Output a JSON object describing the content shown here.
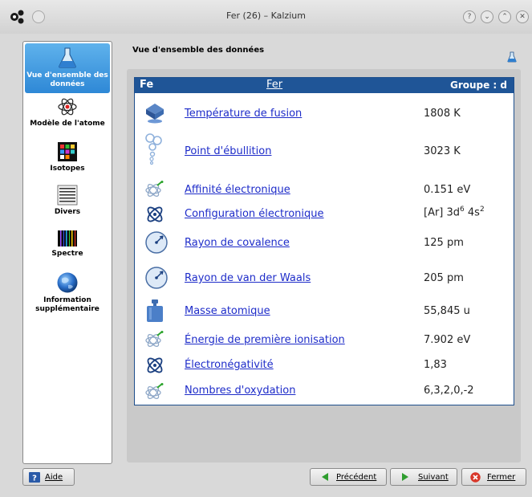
{
  "window": {
    "title": "Fer (26) – Kalzium"
  },
  "sidebar": {
    "items": [
      {
        "label": "Vue d'ensemble des données",
        "icon": "flask-icon",
        "active": true
      },
      {
        "label": "Modèle de l'atome",
        "icon": "atom-icon"
      },
      {
        "label": "Isotopes",
        "icon": "isotopes-icon"
      },
      {
        "label": "Divers",
        "icon": "misc-icon"
      },
      {
        "label": "Spectre",
        "icon": "spectrum-icon"
      },
      {
        "label": "Information supplémentaire",
        "icon": "globe-icon"
      }
    ]
  },
  "main": {
    "title": "Vue d'ensemble des données",
    "table": {
      "symbol": "Fe",
      "name": "Fer",
      "group": "Groupe : d",
      "rows": [
        {
          "label": "Température de fusion",
          "value": "1808 K",
          "icon": "melting-icon"
        },
        {
          "label": "Point d'ébullition",
          "value": "3023 K",
          "icon": "boiling-icon"
        },
        {
          "label": "Affinité électronique",
          "value": "0.151 eV",
          "icon": "electron-affinity-icon"
        },
        {
          "label": "Configuration électronique",
          "value_base": "[Ar] 3d",
          "value_sup1": "6",
          "value_mid": " 4s",
          "value_sup2": "2",
          "icon": "orbital-icon"
        },
        {
          "label": "Rayon de covalence",
          "value": "125 pm",
          "icon": "radius-icon"
        },
        {
          "label": "Rayon de van der Waals",
          "value": "205 pm",
          "icon": "radius-icon"
        },
        {
          "label": "Masse atomique",
          "value": "55,845 u",
          "icon": "mass-icon"
        },
        {
          "label": "Énergie de première ionisation",
          "value": "7.902 eV",
          "icon": "ionization-icon"
        },
        {
          "label": "Électronégativité",
          "value": "1,83",
          "icon": "orbital-icon"
        },
        {
          "label": "Nombres d'oxydation",
          "value": "6,3,2,0,-2",
          "icon": "oxidation-icon"
        }
      ]
    }
  },
  "footer": {
    "help": "Aide",
    "previous": "Précédent",
    "next": "Suivant",
    "close": "Fermer"
  }
}
